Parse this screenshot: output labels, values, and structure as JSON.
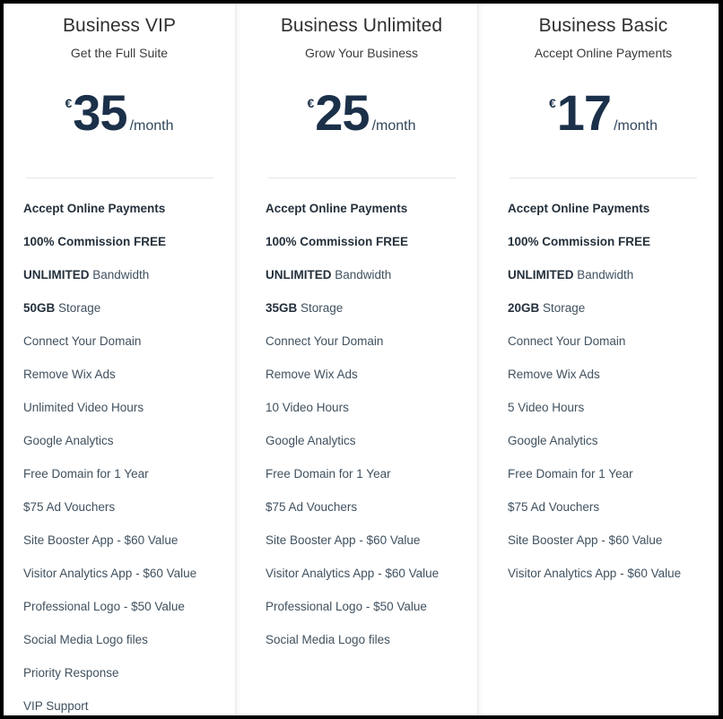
{
  "pricing_table": {
    "currency_symbol": "€",
    "period_label": "/month",
    "accent_color": "#1b3049",
    "title_color": "#2f2f2f",
    "feature_color": "#40515f",
    "divider_color": "#e4e6e8",
    "plans": [
      {
        "name": "Business VIP",
        "tagline": "Get the Full Suite",
        "currency": "€",
        "price": "35",
        "period": "/month",
        "features": [
          {
            "strong": "Accept Online Payments",
            "rest": "",
            "all_bold": true
          },
          {
            "strong": "100% Commission FREE",
            "rest": "",
            "all_bold": true
          },
          {
            "strong": "UNLIMITED",
            "rest": " Bandwidth",
            "all_bold": false
          },
          {
            "strong": "50GB",
            "rest": " Storage",
            "all_bold": false
          },
          {
            "strong": "",
            "rest": "Connect Your Domain",
            "all_bold": false
          },
          {
            "strong": "",
            "rest": "Remove Wix Ads",
            "all_bold": false
          },
          {
            "strong": "",
            "rest": "Unlimited Video Hours",
            "all_bold": false
          },
          {
            "strong": "",
            "rest": "Google Analytics",
            "all_bold": false
          },
          {
            "strong": "",
            "rest": "Free Domain for 1 Year",
            "all_bold": false
          },
          {
            "strong": "",
            "rest": "$75 Ad Vouchers",
            "all_bold": false
          },
          {
            "strong": "",
            "rest": "Site Booster App - $60 Value",
            "all_bold": false
          },
          {
            "strong": "",
            "rest": "Visitor Analytics App - $60 Value",
            "all_bold": false
          },
          {
            "strong": "",
            "rest": "Professional Logo - $50 Value",
            "all_bold": false
          },
          {
            "strong": "",
            "rest": "Social Media Logo files",
            "all_bold": false
          },
          {
            "strong": "",
            "rest": "Priority Response",
            "all_bold": false
          },
          {
            "strong": "",
            "rest": "VIP Support",
            "all_bold": false
          }
        ]
      },
      {
        "name": "Business Unlimited",
        "tagline": "Grow Your Business",
        "currency": "€",
        "price": "25",
        "period": "/month",
        "features": [
          {
            "strong": "Accept Online Payments",
            "rest": "",
            "all_bold": true
          },
          {
            "strong": "100% Commission FREE",
            "rest": "",
            "all_bold": true
          },
          {
            "strong": "UNLIMITED",
            "rest": " Bandwidth",
            "all_bold": false
          },
          {
            "strong": "35GB",
            "rest": " Storage",
            "all_bold": false
          },
          {
            "strong": "",
            "rest": "Connect Your Domain",
            "all_bold": false
          },
          {
            "strong": "",
            "rest": "Remove Wix Ads",
            "all_bold": false
          },
          {
            "strong": "",
            "rest": "10 Video Hours",
            "all_bold": false
          },
          {
            "strong": "",
            "rest": "Google Analytics",
            "all_bold": false
          },
          {
            "strong": "",
            "rest": "Free Domain for 1 Year",
            "all_bold": false
          },
          {
            "strong": "",
            "rest": "$75 Ad Vouchers",
            "all_bold": false
          },
          {
            "strong": "",
            "rest": "Site Booster App - $60 Value",
            "all_bold": false
          },
          {
            "strong": "",
            "rest": "Visitor Analytics App - $60 Value",
            "all_bold": false
          },
          {
            "strong": "",
            "rest": "Professional Logo - $50 Value",
            "all_bold": false
          },
          {
            "strong": "",
            "rest": "Social Media Logo files",
            "all_bold": false
          }
        ]
      },
      {
        "name": "Business Basic",
        "tagline": "Accept Online Payments",
        "currency": "€",
        "price": "17",
        "period": "/month",
        "features": [
          {
            "strong": "Accept Online Payments",
            "rest": "",
            "all_bold": true
          },
          {
            "strong": "100% Commission FREE",
            "rest": "",
            "all_bold": true
          },
          {
            "strong": "UNLIMITED",
            "rest": " Bandwidth",
            "all_bold": false
          },
          {
            "strong": "20GB",
            "rest": " Storage",
            "all_bold": false
          },
          {
            "strong": "",
            "rest": "Connect Your Domain",
            "all_bold": false
          },
          {
            "strong": "",
            "rest": "Remove Wix Ads",
            "all_bold": false
          },
          {
            "strong": "",
            "rest": "5 Video Hours",
            "all_bold": false
          },
          {
            "strong": "",
            "rest": "Google Analytics",
            "all_bold": false
          },
          {
            "strong": "",
            "rest": "Free Domain for 1 Year",
            "all_bold": false
          },
          {
            "strong": "",
            "rest": "$75 Ad Vouchers",
            "all_bold": false
          },
          {
            "strong": "",
            "rest": "Site Booster App - $60 Value",
            "all_bold": false
          },
          {
            "strong": "",
            "rest": "Visitor Analytics App - $60 Value",
            "all_bold": false
          }
        ]
      }
    ]
  }
}
